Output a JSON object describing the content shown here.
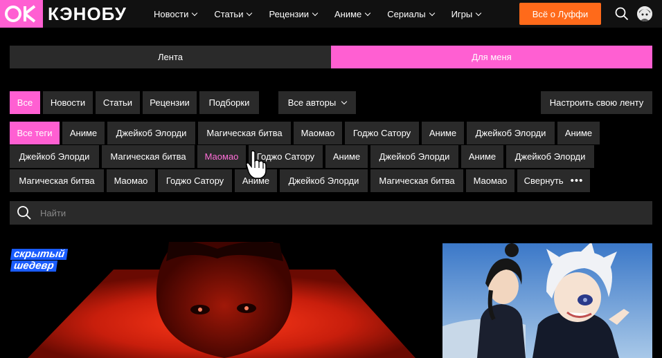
{
  "header": {
    "logo_text": "КЭНОБУ",
    "nav": [
      "Новости",
      "Статьи",
      "Рецензии",
      "Аниме",
      "Сериалы",
      "Игры"
    ],
    "cta_label": "Всё о Луффи"
  },
  "feed_toggle": {
    "left": "Лента",
    "right": "Для меня"
  },
  "filters": {
    "types": [
      "Все",
      "Новости",
      "Статьи",
      "Рецензии",
      "Подборки"
    ],
    "authors_label": "Все авторы",
    "customize_label": "Настроить свою ленту"
  },
  "tags": {
    "row1": [
      "Все теги",
      "Аниме",
      "Джейкоб Элорди",
      "Магическая битва",
      "Маомао",
      "Годжо Сатору",
      "Аниме",
      "Джейкоб Элорди",
      "Аниме"
    ],
    "row2": [
      "Джейкоб Элорди",
      "Магическая битва",
      "Маомао",
      "Годжо Сатору",
      "Аниме",
      "Джейкоб Элорди",
      "Аниме",
      "Джейкоб Элорди"
    ],
    "row3": [
      "Магическая битва",
      "Маомао",
      "Годжо Сатору",
      "Аниме",
      "Джейкоб Элорди",
      "Магическая битва",
      "Маомао",
      "Свернуть"
    ]
  },
  "search": {
    "placeholder": "Найти"
  },
  "card_badge": {
    "line1": "скрытый",
    "line2": "шедевр"
  },
  "colors": {
    "accent_pink": "#ff5fd2",
    "cta_orange": "#ff6a1a",
    "chip_bg": "#2a2a2a",
    "badge_blue": "#1a5cff"
  }
}
